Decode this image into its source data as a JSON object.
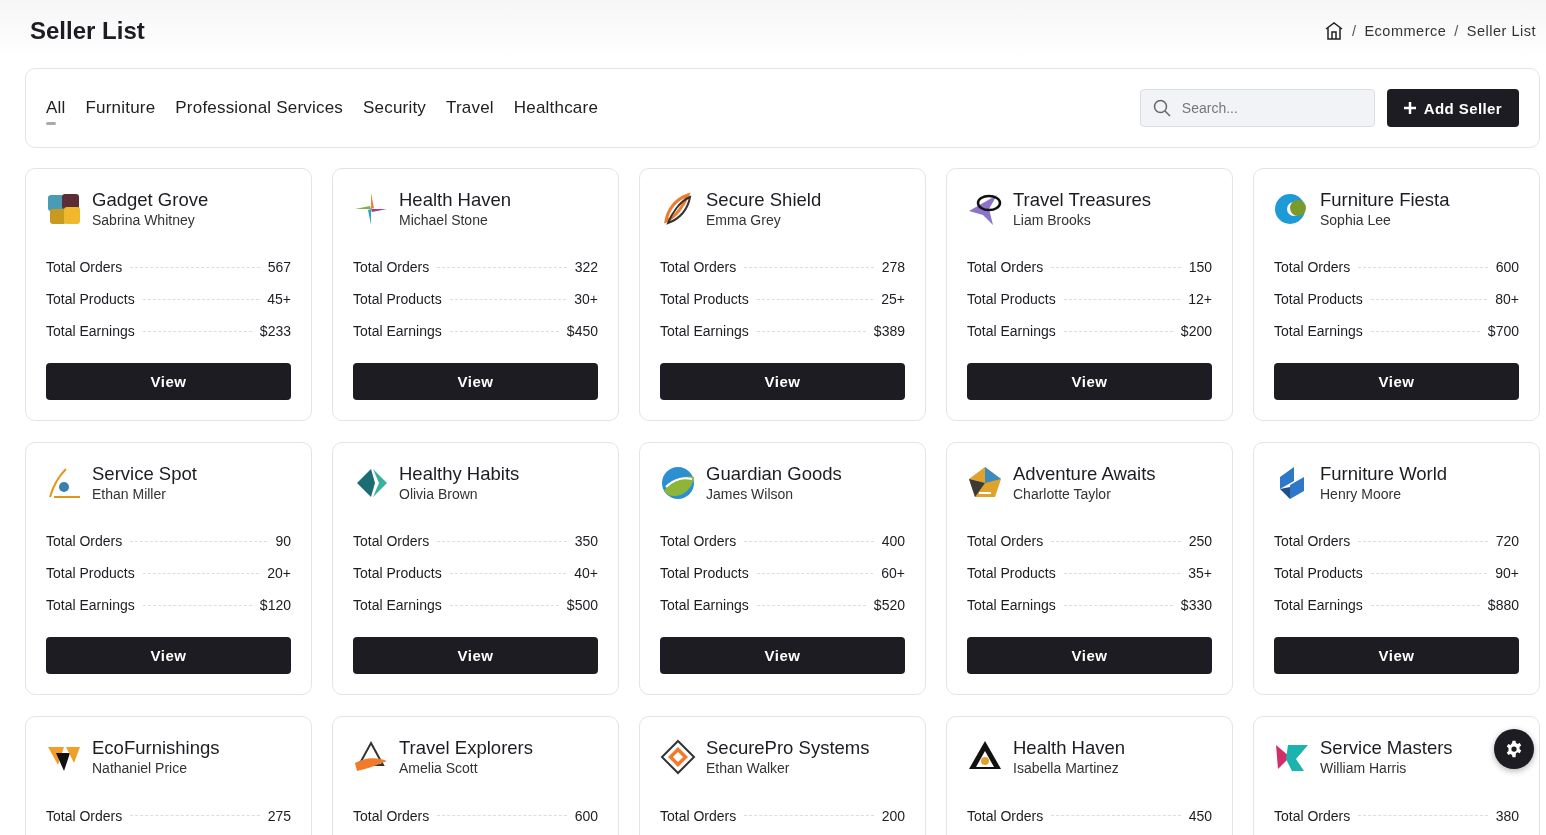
{
  "page_title": "Seller List",
  "breadcrumb": [
    "Ecommerce",
    "Seller List"
  ],
  "breadcrumb_separator": "/",
  "tabs": [
    {
      "label": "All",
      "selected": true
    },
    {
      "label": "Furniture",
      "selected": false
    },
    {
      "label": "Professional Services",
      "selected": false
    },
    {
      "label": "Security",
      "selected": false
    },
    {
      "label": "Travel",
      "selected": false
    },
    {
      "label": "Healthcare",
      "selected": false
    }
  ],
  "search": {
    "placeholder": "Search..."
  },
  "add_button": "Add Seller",
  "sellers": [
    {
      "name": "Gadget Grove",
      "owner": "Sabrina Whitney",
      "stats": [
        {
          "label": "Total Orders",
          "value": "567"
        },
        {
          "label": "Total Products",
          "value": "45+"
        },
        {
          "label": "Total Earnings",
          "value": "$233"
        }
      ],
      "button": "View"
    },
    {
      "name": "Health Haven",
      "owner": "Michael Stone",
      "stats": [
        {
          "label": "Total Orders",
          "value": "322"
        },
        {
          "label": "Total Products",
          "value": "30+"
        },
        {
          "label": "Total Earnings",
          "value": "$450"
        }
      ],
      "button": "View"
    },
    {
      "name": "Secure Shield",
      "owner": "Emma Grey",
      "stats": [
        {
          "label": "Total Orders",
          "value": "278"
        },
        {
          "label": "Total Products",
          "value": "25+"
        },
        {
          "label": "Total Earnings",
          "value": "$389"
        }
      ],
      "button": "View"
    },
    {
      "name": "Travel Treasures",
      "owner": "Liam Brooks",
      "stats": [
        {
          "label": "Total Orders",
          "value": "150"
        },
        {
          "label": "Total Products",
          "value": "12+"
        },
        {
          "label": "Total Earnings",
          "value": "$200"
        }
      ],
      "button": "View"
    },
    {
      "name": "Furniture Fiesta",
      "owner": "Sophia Lee",
      "stats": [
        {
          "label": "Total Orders",
          "value": "600"
        },
        {
          "label": "Total Products",
          "value": "80+"
        },
        {
          "label": "Total Earnings",
          "value": "$700"
        }
      ],
      "button": "View"
    },
    {
      "name": "Service Spot",
      "owner": "Ethan Miller",
      "stats": [
        {
          "label": "Total Orders",
          "value": "90"
        },
        {
          "label": "Total Products",
          "value": "20+"
        },
        {
          "label": "Total Earnings",
          "value": "$120"
        }
      ],
      "button": "View"
    },
    {
      "name": "Healthy Habits",
      "owner": "Olivia Brown",
      "stats": [
        {
          "label": "Total Orders",
          "value": "350"
        },
        {
          "label": "Total Products",
          "value": "40+"
        },
        {
          "label": "Total Earnings",
          "value": "$500"
        }
      ],
      "button": "View"
    },
    {
      "name": "Guardian Goods",
      "owner": "James Wilson",
      "stats": [
        {
          "label": "Total Orders",
          "value": "400"
        },
        {
          "label": "Total Products",
          "value": "60+"
        },
        {
          "label": "Total Earnings",
          "value": "$520"
        }
      ],
      "button": "View"
    },
    {
      "name": "Adventure Awaits",
      "owner": "Charlotte Taylor",
      "stats": [
        {
          "label": "Total Orders",
          "value": "250"
        },
        {
          "label": "Total Products",
          "value": "35+"
        },
        {
          "label": "Total Earnings",
          "value": "$330"
        }
      ],
      "button": "View"
    },
    {
      "name": "Furniture World",
      "owner": "Henry Moore",
      "stats": [
        {
          "label": "Total Orders",
          "value": "720"
        },
        {
          "label": "Total Products",
          "value": "90+"
        },
        {
          "label": "Total Earnings",
          "value": "$880"
        }
      ],
      "button": "View"
    },
    {
      "name": "EcoFurnishings",
      "owner": "Nathaniel Price",
      "stats": [
        {
          "label": "Total Orders",
          "value": "275"
        }
      ]
    },
    {
      "name": "Travel Explorers",
      "owner": "Amelia Scott",
      "stats": [
        {
          "label": "Total Orders",
          "value": "600"
        }
      ]
    },
    {
      "name": "SecurePro Systems",
      "owner": "Ethan Walker",
      "stats": [
        {
          "label": "Total Orders",
          "value": "200"
        }
      ]
    },
    {
      "name": "Health Haven",
      "owner": "Isabella Martinez",
      "stats": [
        {
          "label": "Total Orders",
          "value": "450"
        }
      ]
    },
    {
      "name": "Service Masters",
      "owner": "William Harris",
      "stats": [
        {
          "label": "Total Orders",
          "value": "380"
        }
      ]
    }
  ]
}
